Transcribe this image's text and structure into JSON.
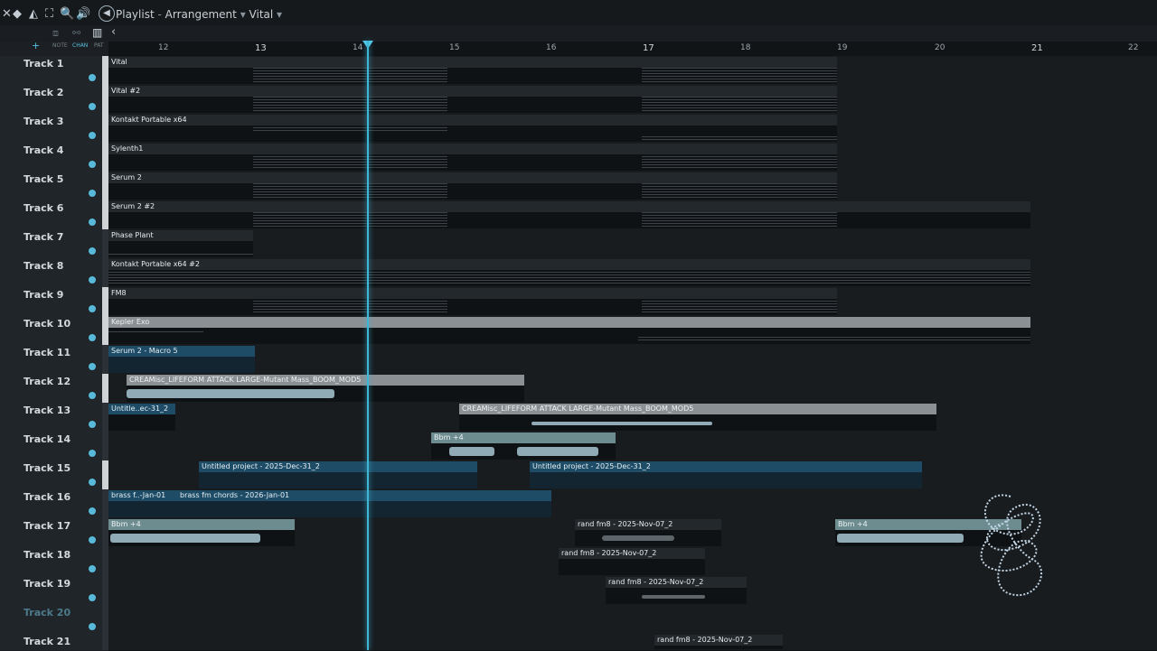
{
  "window": {
    "title_parts": [
      "Playlist",
      "Arrangement",
      "Vital"
    ]
  },
  "toolbar": {
    "mini_labels": [
      "NOTE",
      "CHAN",
      "PAT"
    ],
    "back_label": "‹"
  },
  "ruler": {
    "labels": [
      "12",
      "13",
      "14",
      "15",
      "16",
      "17",
      "18",
      "19",
      "20",
      "21",
      "22"
    ]
  },
  "tracks": [
    {
      "name": "Track 1"
    },
    {
      "name": "Track 2"
    },
    {
      "name": "Track 3"
    },
    {
      "name": "Track 4"
    },
    {
      "name": "Track 5"
    },
    {
      "name": "Track 6"
    },
    {
      "name": "Track 7"
    },
    {
      "name": "Track 8"
    },
    {
      "name": "Track 9"
    },
    {
      "name": "Track 10"
    },
    {
      "name": "Track 11"
    },
    {
      "name": "Track 12"
    },
    {
      "name": "Track 13"
    },
    {
      "name": "Track 14"
    },
    {
      "name": "Track 15"
    },
    {
      "name": "Track 16"
    },
    {
      "name": "Track 17"
    },
    {
      "name": "Track 18"
    },
    {
      "name": "Track 19"
    },
    {
      "name": "Track 20"
    },
    {
      "name": "Track 21"
    }
  ],
  "clips": {
    "t1": "Vital",
    "t2": "Vital #2",
    "t3": "Kontakt Portable x64",
    "t4": "Sylenth1",
    "t5": "Serum 2",
    "t6": "Serum 2 #2",
    "t7": "Phase Plant",
    "t8": "Kontakt Portable x64 #2",
    "t9": "FM8",
    "t10": "Kepler Exo",
    "t11": "Serum 2 - Macro 5",
    "t12": "CREAMisc_LIFEFORM ATTACK LARGE-Mutant Mass_BOOM_MOD5",
    "t13a": "Untitle..ec-31_2",
    "t13b": "CREAMisc_LIFEFORM ATTACK LARGE-Mutant Mass_BOOM_MOD5",
    "t14": "Bbm +4",
    "t15a": "Untitled project - 2025-Dec-31_2",
    "t15b": "Untitled project - 2025-Dec-31_2",
    "t16a": "brass f..-Jan-01",
    "t16b": "brass fm chords - 2026-Jan-01",
    "t17a": "Bbm +4",
    "t17b": "rand fm8 - 2025-Nov-07_2",
    "t17c": "Bbm +4",
    "t18": "rand fm8 - 2025-Nov-07_2",
    "t19": "rand fm8 - 2025-Nov-07_2",
    "t21": "rand fm8 - 2025-Nov-07_2"
  },
  "colors": {
    "accent": "#3fb6d6",
    "audio_clip": "#6d8c90",
    "automation_clip": "#1e4c66",
    "pattern_header": "#8b9094"
  }
}
